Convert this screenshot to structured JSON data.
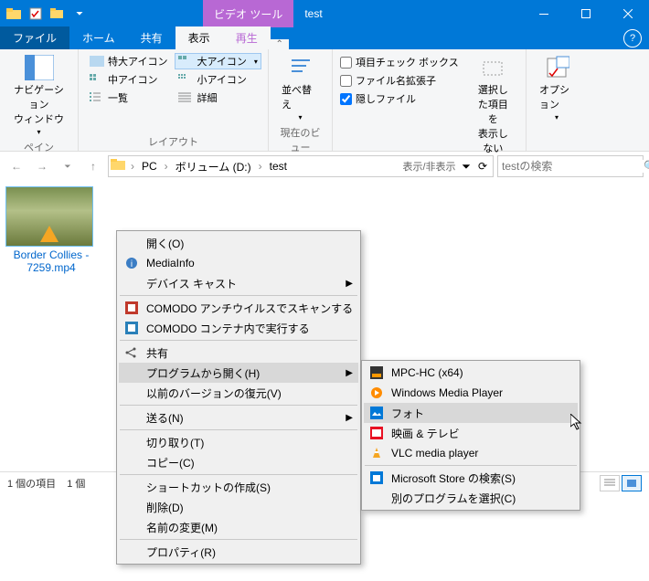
{
  "window": {
    "tool_tab": "ビデオ ツール",
    "title": "test",
    "tabs": {
      "file": "ファイル",
      "home": "ホーム",
      "share": "共有",
      "view": "表示",
      "play": "再生"
    }
  },
  "ribbon": {
    "pane": {
      "nav": "ナビゲーション\nウィンドウ",
      "label": "ペイン"
    },
    "layout": {
      "xl": "特大アイコン",
      "lg": "大アイコン",
      "md": "中アイコン",
      "sm": "小アイコン",
      "list": "一覧",
      "details": "詳細",
      "label": "レイアウト"
    },
    "sort": {
      "btn": "並べ替え",
      "label": "現在のビュー"
    },
    "show": {
      "chk_item": "項目チェック ボックス",
      "chk_ext": "ファイル名拡張子",
      "chk_hidden": "隠しファイル",
      "hide_sel": "選択した項目を\n表示しない",
      "label": "表示/非表示"
    },
    "options": {
      "btn": "オプション"
    }
  },
  "address": {
    "crumbs": {
      "pc": "PC",
      "vol": "ボリューム (D:)",
      "folder": "test"
    },
    "search_ph": "testの検索"
  },
  "file": {
    "name": "Border Collies - 7259.mp4"
  },
  "status": {
    "count": "1 個の項目",
    "sel": "1 個"
  },
  "ctx1": {
    "open": "開く(O)",
    "mediainfo": "MediaInfo",
    "cast": "デバイス キャスト",
    "comodo_scan": "COMODO アンチウイルスでスキャンする",
    "comodo_run": "COMODO コンテナ内で実行する",
    "share": "共有",
    "openwith": "プログラムから開く(H)",
    "prev_ver": "以前のバージョンの復元(V)",
    "sendto": "送る(N)",
    "cut": "切り取り(T)",
    "copy": "コピー(C)",
    "shortcut": "ショートカットの作成(S)",
    "delete": "削除(D)",
    "rename": "名前の変更(M)",
    "props": "プロパティ(R)"
  },
  "ctx2": {
    "mpc": "MPC-HC (x64)",
    "wmp": "Windows Media Player",
    "photos": "フォト",
    "movies": "映画 & テレビ",
    "vlc": "VLC media player",
    "store": "Microsoft Store の検索(S)",
    "choose": "別のプログラムを選択(C)"
  }
}
